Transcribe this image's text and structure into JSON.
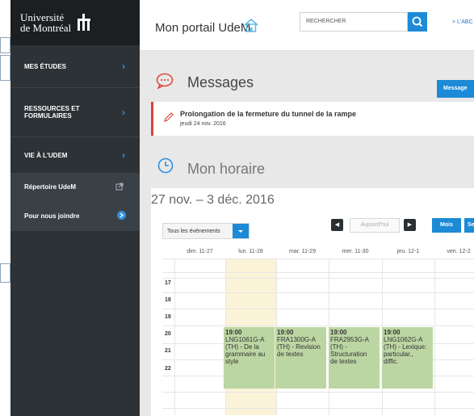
{
  "sidebar": {
    "logo_line1": "Université",
    "logo_line2": "de Montréal",
    "items": [
      {
        "label": "MES ÉTUDES",
        "icon": "chevron-right-icon"
      },
      {
        "label": "RESSOURCES ET",
        "label2": "FORMULAIRES",
        "icon": "chevron-right-icon"
      },
      {
        "label": "VIE À L'UDEM",
        "icon": "chevron-right-icon"
      },
      {
        "label": "Répertoire UdeM",
        "icon": "external-link-icon"
      },
      {
        "label": "Pour nous joindre",
        "icon": "circle-chevron-icon"
      }
    ]
  },
  "header": {
    "title": "Mon portail UdeM",
    "search_placeholder": "RECHERCHER",
    "abo_link": "> L'ABC"
  },
  "messages": {
    "title": "Messages",
    "button": "Message",
    "item_title": "Prolongation de la fermeture du tunnel de la rampe",
    "item_date": "jeudi 24 nov. 2016"
  },
  "schedule": {
    "title": "Mon horaire",
    "week": "27 nov. – 3 déc. 2016",
    "filter": "Tous les événements",
    "today_button": "Aujourd'hui",
    "view_month": "Mois",
    "view_week": "Se",
    "days": [
      "dim. 11-27",
      "lun. 11-28",
      "mar. 11-29",
      "mer. 11-30",
      "jeu. 12-1",
      "ven. 12-2"
    ],
    "hours": [
      "17",
      "18",
      "19",
      "20",
      "21",
      "22"
    ],
    "events": [
      {
        "time": "19:00",
        "line1": "LNG1061G-A",
        "line2": "(TH) - De la",
        "line3": "grammaire au",
        "line4": "style"
      },
      {
        "time": "19:00",
        "line1": "FRA1300G-A",
        "line2": "(TH) - Revision",
        "line3": "de textes",
        "line4": ""
      },
      {
        "time": "19:00",
        "line1": "FRA2953G-A",
        "line2": "(TH) -",
        "line3": "Structuration",
        "line4": "de textes"
      },
      {
        "time": "19:00",
        "line1": "LNG1062G-A",
        "line2": "(TH) - Lexique:",
        "line3": "particular.,",
        "line4": "diffic."
      }
    ]
  },
  "colors": {
    "accent": "#1d8ad8",
    "sidebar": "#2c3236",
    "event": "#bcd6a3",
    "alert": "#d9443a"
  }
}
